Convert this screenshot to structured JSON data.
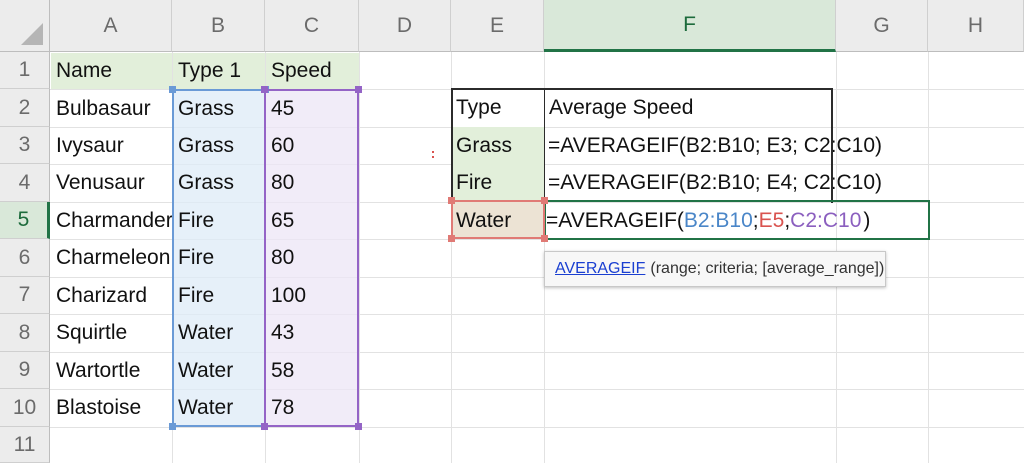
{
  "columns": [
    "A",
    "B",
    "C",
    "D",
    "E",
    "F",
    "G",
    "H"
  ],
  "rows": [
    "1",
    "2",
    "3",
    "4",
    "5",
    "6",
    "7",
    "8",
    "9",
    "10",
    "11"
  ],
  "active_column": "F",
  "active_row": "5",
  "data_table": {
    "headers": [
      "Name",
      "Type 1",
      "Speed"
    ],
    "rows": [
      [
        "Bulbasaur",
        "Grass",
        "45"
      ],
      [
        "Ivysaur",
        "Grass",
        "60"
      ],
      [
        "Venusaur",
        "Grass",
        "80"
      ],
      [
        "Charmander",
        "Fire",
        "65"
      ],
      [
        "Charmeleon",
        "Fire",
        "80"
      ],
      [
        "Charizard",
        "Fire",
        "100"
      ],
      [
        "Squirtle",
        "Water",
        "43"
      ],
      [
        "Wartortle",
        "Water",
        "58"
      ],
      [
        "Blastoise",
        "Water",
        "78"
      ]
    ]
  },
  "summary_table": {
    "header_type": "Type",
    "header_avg": "Average Speed",
    "rows": [
      {
        "type": "Grass",
        "formula": "=AVERAGEIF(B2:B10; E3; C2:C10)"
      },
      {
        "type": "Fire",
        "formula": "=AVERAGEIF(B2:B10; E4; C2:C10)"
      },
      {
        "type": "Water",
        "formula_parts": {
          "prefix": "=AVERAGEIF(",
          "range": "B2:B10",
          "sep1": "; ",
          "criteria": "E5",
          "sep2": "; ",
          "avg_range": "C2:C10",
          "suffix": ")"
        }
      }
    ]
  },
  "tooltip": {
    "function_name": "AVERAGEIF",
    "args": "(range; criteria; [average_range])"
  },
  "colors": {
    "range_blue": "#4a86c8",
    "criteria_red": "#d9534f",
    "avg_range_purple": "#8b5fbf",
    "selection_green": "#217346"
  }
}
